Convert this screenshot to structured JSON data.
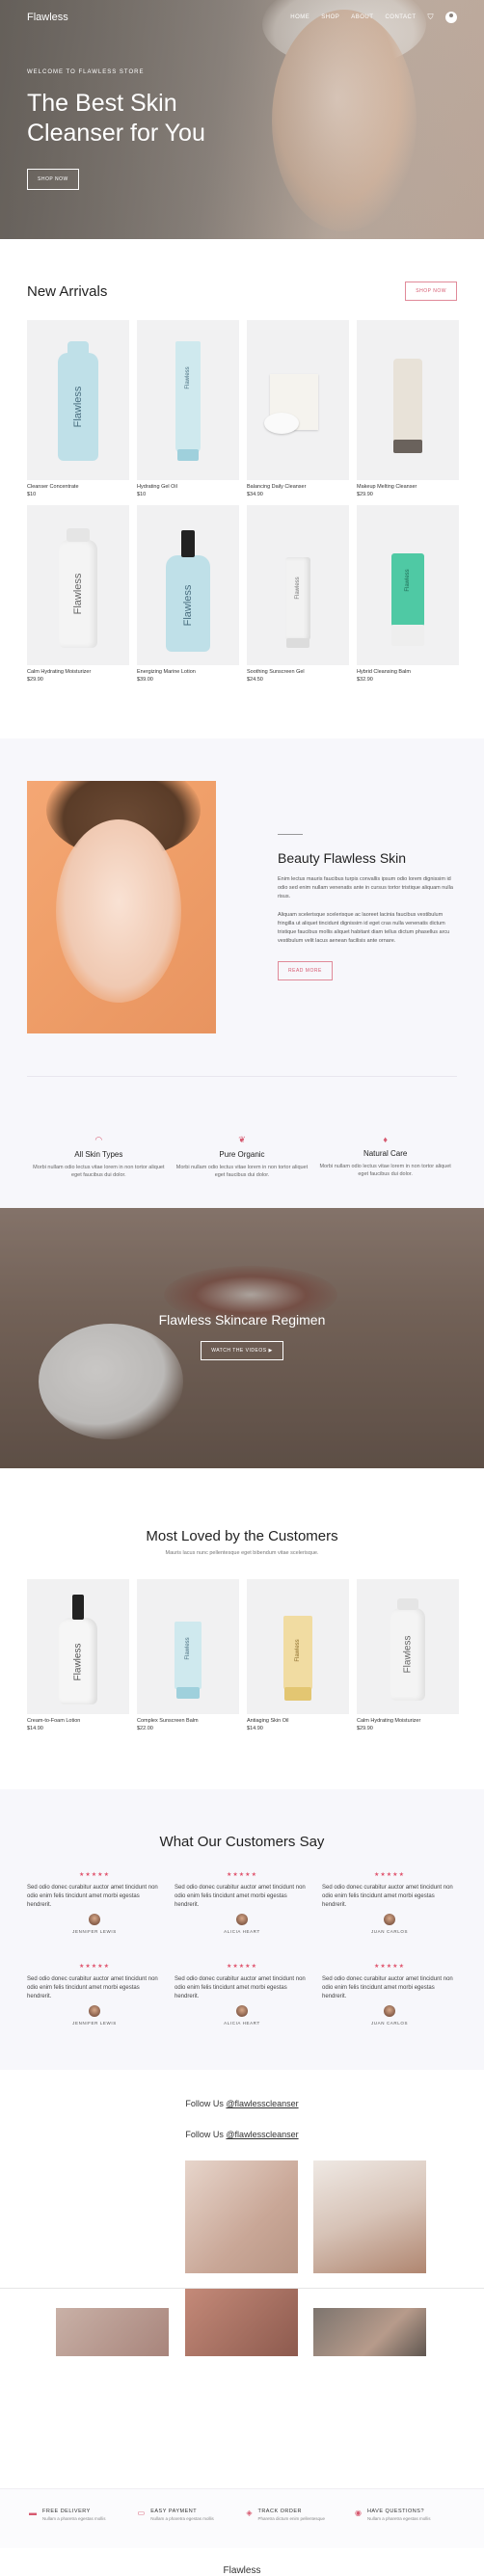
{
  "nav": {
    "logo": "Flawless",
    "links": [
      "HOME",
      "SHOP",
      "ABOUT",
      "CONTACT"
    ],
    "cart_icon": "cart-icon",
    "user_icon": "user-icon"
  },
  "hero": {
    "eyebrow": "WELCOME TO FLAWLESS STORE",
    "title_line1": "The Best Skin",
    "title_line2": "Cleanser for You",
    "button": "SHOP NOW"
  },
  "new_arrivals": {
    "title": "New Arrivals",
    "button": "SHOP NOW",
    "products": [
      {
        "name": "Cleanser Concentrate",
        "price": "$10"
      },
      {
        "name": "Hydrating Gel Oil",
        "price": "$10"
      },
      {
        "name": "Balancing Daily Cleanser",
        "price": "$34.90"
      },
      {
        "name": "Makeup Melting Cleanser",
        "price": "$29.90"
      },
      {
        "name": "Calm Hydrating Moisturizer",
        "price": "$29.90"
      },
      {
        "name": "Energizing Marine Lotion",
        "price": "$39.00"
      },
      {
        "name": "Soothing Sunscreen Gel",
        "price": "$24.50"
      },
      {
        "name": "Hybrid Cleansing Balm",
        "price": "$32.90"
      }
    ],
    "bottle_label": "Flawless"
  },
  "about": {
    "title": "Beauty Flawless Skin",
    "para1": "Enim lectus mauris faucibus turpis convallis ipsum odio lorem dignissim id odio sed enim nullam venenatis ante in cursus tortor tristique aliquam nulla risus.",
    "para2": "Aliquam scelerisque scelerisque ac laoreet lacinia faucibus vestibulum fringilla ut aliquet tincidunt dignissim id eget cras nulla venenatis dictum tristique faucibus mollis aliquet habitant diam tellus dictum phasellus arcu vestibulum velit lacus aenean facilisis ante ornare.",
    "button": "READ MORE"
  },
  "features": [
    {
      "icon": "lips-icon",
      "title": "All Skin Types",
      "text": "Morbi nullam odio lectus vitae lorem in non tortor aliquet eget faucibus dui dolor."
    },
    {
      "icon": "leaf-icon",
      "title": "Pure Organic",
      "text": "Morbi nullam odio lectus vitae lorem in non tortor aliquet eget faucibus dui dolor."
    },
    {
      "icon": "drop-icon",
      "title": "Natural Care",
      "text": "Morbi nullam odio lectus vitae lorem in non tortor aliquet eget faucibus dui dolor."
    }
  ],
  "regimen": {
    "title": "Flawless Skincare Regimen",
    "button": "WATCH THE VIDEOS"
  },
  "loved": {
    "title": "Most Loved by the Customers",
    "subtitle": "Mauris lacus nunc pellentesque eget bibendum vitae scelerisque.",
    "products": [
      {
        "name": "Cream-to-Foam Lotion",
        "price": "$14.90"
      },
      {
        "name": "Complex Sunscreen Balm",
        "price": "$22.00"
      },
      {
        "name": "Antiaging Skin Oil",
        "price": "$14.90"
      },
      {
        "name": "Calm Hydrating Moisturizer",
        "price": "$29.90"
      }
    ]
  },
  "testimonials": {
    "title": "What Our Customers Say",
    "stars": "★★★★★",
    "items": [
      {
        "text": "Sed odio donec curabitur auctor amet tincidunt non odio enim felis tincidunt amet morbi egestas hendrerit.",
        "name": "JENNIFER LEWIS"
      },
      {
        "text": "Sed odio donec curabitur auctor amet tincidunt non odio enim felis tincidunt amet morbi egestas hendrerit.",
        "name": "ALICIA HEART"
      },
      {
        "text": "Sed odio donec curabitur auctor amet tincidunt non odio enim felis tincidunt amet morbi egestas hendrerit.",
        "name": "JUAN CARLOS"
      },
      {
        "text": "Sed odio donec curabitur auctor amet tincidunt non odio enim felis tincidunt amet morbi egestas hendrerit.",
        "name": "JENNIFER LEWIS"
      },
      {
        "text": "Sed odio donec curabitur auctor amet tincidunt non odio enim felis tincidunt amet morbi egestas hendrerit.",
        "name": "ALICIA HEART"
      },
      {
        "text": "Sed odio donec curabitur auctor amet tincidunt non odio enim felis tincidunt amet morbi egestas hendrerit.",
        "name": "JUAN CARLOS"
      }
    ]
  },
  "instagram": {
    "follow_text": "Follow Us ",
    "handle": "@flawlesscleanser"
  },
  "perks": [
    {
      "icon": "truck-icon",
      "title": "FREE DELIVERY",
      "text": "Nullam a pharetra egestas mollis"
    },
    {
      "icon": "wallet-icon",
      "title": "EASY PAYMENT",
      "text": "Nullam a pharetra egestas mollis"
    },
    {
      "icon": "box-icon",
      "title": "TRACK ORDER",
      "text": "Pharetra dictum enim pellentesque"
    },
    {
      "icon": "chat-icon",
      "title": "HAVE QUESTIONS?",
      "text": "Nullam a pharetra egestas mollis"
    }
  ],
  "footer": {
    "brand": "Flawless"
  },
  "colors": {
    "accent": "#d65a70",
    "soft_bg": "#f7f7fb",
    "card_bg": "#f1f1f2"
  }
}
